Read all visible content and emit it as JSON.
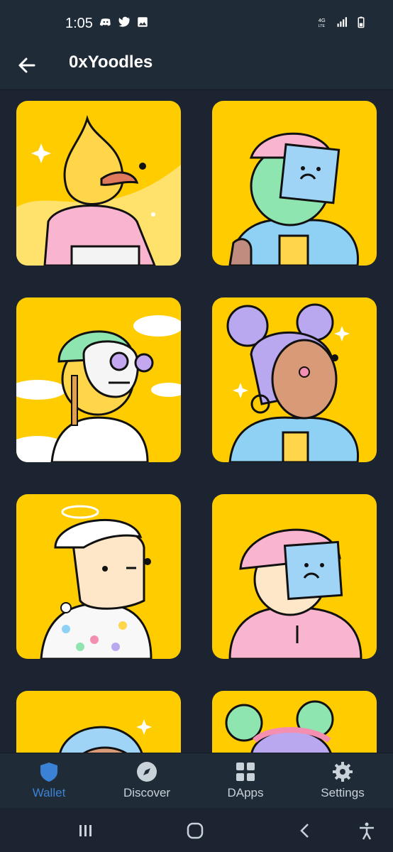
{
  "status_bar": {
    "time": "1:05",
    "left_icons": [
      "discord-icon",
      "twitter-icon",
      "image-icon"
    ],
    "right_icons": [
      "4g-lte-icon",
      "signal-icon",
      "battery-icon"
    ]
  },
  "header": {
    "title": "0xYoodles",
    "back_icon": "arrow-left-icon"
  },
  "nfts": [
    {
      "name": "flame-head-character"
    },
    {
      "name": "sticky-note-face-beanie-character"
    },
    {
      "name": "skull-helmet-character"
    },
    {
      "name": "space-buns-girl-character"
    },
    {
      "name": "halo-character"
    },
    {
      "name": "bucket-hat-sticky-note-character"
    },
    {
      "name": "blue-hair-character"
    },
    {
      "name": "green-buns-character"
    }
  ],
  "bottom_nav": {
    "items": [
      {
        "label": "Wallet",
        "icon": "shield-icon",
        "active": true
      },
      {
        "label": "Discover",
        "icon": "compass-icon",
        "active": false
      },
      {
        "label": "DApps",
        "icon": "grid-icon",
        "active": false
      },
      {
        "label": "Settings",
        "icon": "gear-icon",
        "active": false
      }
    ]
  },
  "colors": {
    "background": "#1b2430",
    "card": "#ffcc00",
    "accent": "#3b82d6"
  }
}
